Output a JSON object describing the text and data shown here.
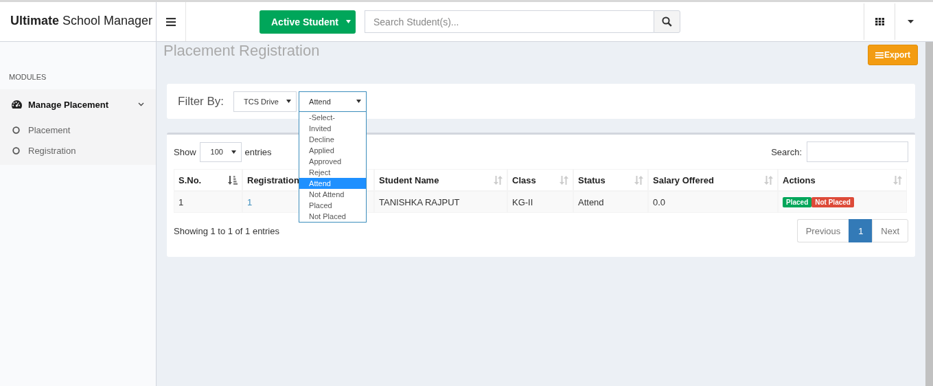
{
  "header": {
    "brand": "**Ultimate** School Manager",
    "mode_button": "Active Student",
    "search": {
      "placeholder": "Search Student(s)..."
    }
  },
  "sidebar": {
    "section": "MODULES",
    "groups": [
      {
        "label": "Manage Placement",
        "expanded": true,
        "children": [
          {
            "label": "Placement"
          },
          {
            "label": "Registration"
          }
        ]
      }
    ]
  },
  "page_title": "Placement Registration",
  "export_button": "Export",
  "filter": {
    "label": "Filter By:",
    "selects": [
      {
        "value": "TCS Drive",
        "open": false
      },
      {
        "value": "Attend",
        "open": true,
        "options": [
          {
            "label": "-Select-",
            "selected": false
          },
          {
            "label": "Invited",
            "selected": false
          },
          {
            "label": "Decline",
            "selected": false
          },
          {
            "label": "Applied",
            "selected": false
          },
          {
            "label": "Approved",
            "selected": false
          },
          {
            "label": "Reject",
            "selected": false
          },
          {
            "label": "Attend",
            "selected": true
          },
          {
            "label": "Not Attend",
            "selected": false
          },
          {
            "label": "Placed",
            "selected": false
          },
          {
            "label": "Not Placed",
            "selected": false
          }
        ]
      }
    ]
  },
  "table": {
    "show_label": "Show",
    "page_length": "100",
    "entries_label": "entries",
    "search_label": "Search:",
    "columns": [
      {
        "label": "S.No.",
        "sorted": true
      },
      {
        "label": "Registration"
      },
      {
        "label": "Student Name",
        "sorted": false
      },
      {
        "label": "Class",
        "sorted": false
      },
      {
        "label": "Status",
        "sorted": false
      },
      {
        "label": "Salary Offered",
        "sorted": false
      },
      {
        "label": "Actions",
        "sorted": false
      }
    ],
    "rows": [
      {
        "cells": [
          "1",
          "1",
          "TANISHKA RAJPUT",
          "KG-II",
          "Attend",
          "0.0"
        ],
        "actions": [
          {
            "label": "Placed",
            "color": "#00a65a"
          },
          {
            "label": "Not Placed",
            "color": "#dd4b39"
          }
        ]
      }
    ],
    "info": "Showing 1 to 1 of 1 entries",
    "pagination": {
      "previous": "Previous",
      "pages": [
        {
          "label": "1",
          "selected": true
        }
      ],
      "next": "Next"
    }
  }
}
